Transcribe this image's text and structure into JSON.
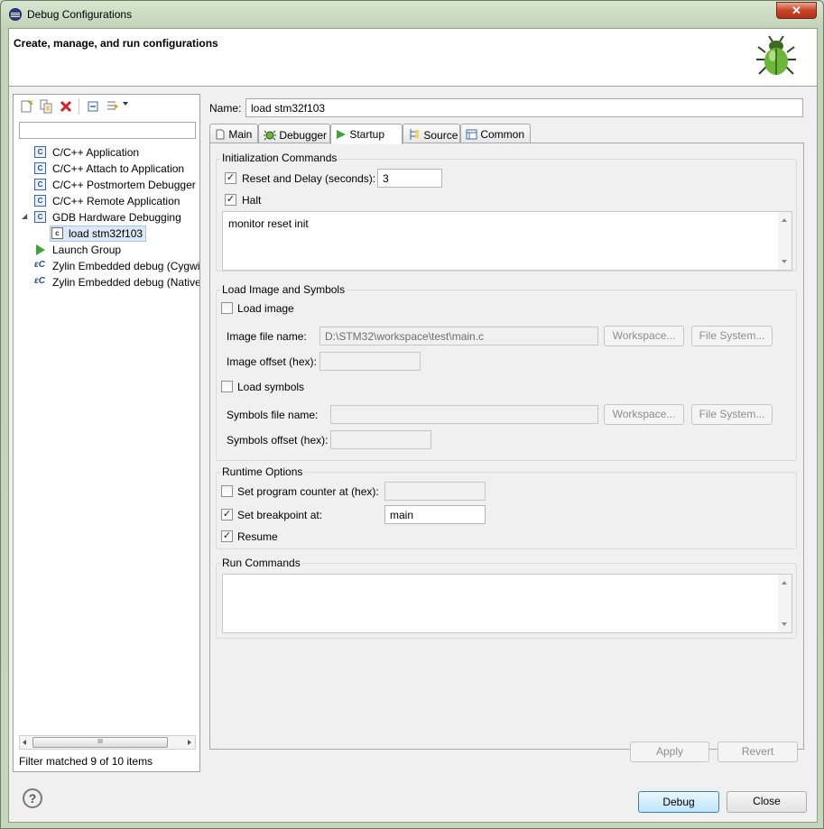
{
  "window": {
    "title": "Debug Configurations",
    "close_glyph": "✕"
  },
  "header": {
    "title": "Create, manage, and run configurations",
    "icon": "bug-icon"
  },
  "left": {
    "toolbar": [
      {
        "name": "new-config-icon"
      },
      {
        "name": "duplicate-config-icon"
      },
      {
        "name": "delete-config-icon"
      },
      {
        "name": "collapse-all-icon"
      },
      {
        "name": "filter-config-icon"
      }
    ],
    "filter_text": "",
    "tree": [
      {
        "label": "C/C++ Application",
        "icon": "c-config-icon",
        "indent": 0,
        "expander": ""
      },
      {
        "label": "C/C++ Attach to Application",
        "icon": "c-config-icon",
        "indent": 0,
        "expander": ""
      },
      {
        "label": "C/C++ Postmortem Debugger",
        "icon": "c-config-icon",
        "indent": 0,
        "expander": ""
      },
      {
        "label": "C/C++ Remote Application",
        "icon": "c-config-icon",
        "indent": 0,
        "expander": ""
      },
      {
        "label": "GDB Hardware Debugging",
        "icon": "c-config-icon",
        "indent": 0,
        "expander": "◢"
      },
      {
        "label": "load stm32f103",
        "icon": "c-config-icon",
        "indent": 1,
        "expander": "",
        "selected": true
      },
      {
        "label": "Launch Group",
        "icon": "launch-group-icon",
        "indent": 0,
        "expander": ""
      },
      {
        "label": "Zylin Embedded debug (Cygwin)",
        "icon": "zylin-icon",
        "indent": 0,
        "expander": ""
      },
      {
        "label": "Zylin Embedded debug (Native)",
        "icon": "zylin-icon",
        "indent": 0,
        "expander": ""
      }
    ],
    "scroll_mark": "III",
    "filter_status": "Filter matched 9 of 10 items"
  },
  "right": {
    "name_label": "Name:",
    "name_value": "load stm32f103",
    "tabs": [
      {
        "label": "Main",
        "icon": "main-tab-icon"
      },
      {
        "label": "Debugger",
        "icon": "debugger-tab-icon"
      },
      {
        "label": "Startup",
        "icon": "startup-tab-icon",
        "selected": true
      },
      {
        "label": "Source",
        "icon": "source-tab-icon"
      },
      {
        "label": "Common",
        "icon": "common-tab-icon"
      }
    ],
    "init": {
      "title": "Initialization Commands",
      "reset_label": "Reset and Delay (seconds):",
      "reset_checked": true,
      "reset_delay": "3",
      "halt_label": "Halt",
      "halt_checked": true,
      "commands": "monitor reset init"
    },
    "load": {
      "title": "Load Image and Symbols",
      "load_image_label": "Load image",
      "load_image_checked": false,
      "image_file_label": "Image file name:",
      "image_file_value": "D:\\STM32\\workspace\\test\\main.c",
      "workspace_label": "Workspace...",
      "filesystem_label": "File System...",
      "image_offset_label": "Image offset (hex):",
      "image_offset_value": "",
      "load_symbols_label": "Load symbols",
      "load_symbols_checked": false,
      "symbols_file_label": "Symbols file name:",
      "symbols_file_value": "",
      "symbols_offset_label": "Symbols offset (hex):",
      "symbols_offset_value": ""
    },
    "runtime": {
      "title": "Runtime Options",
      "pc_label": "Set program counter at (hex):",
      "pc_checked": false,
      "pc_value": "",
      "bp_label": "Set breakpoint at:",
      "bp_checked": true,
      "bp_value": "main",
      "resume_label": "Resume",
      "resume_checked": true
    },
    "run": {
      "title": "Run Commands",
      "commands": ""
    },
    "apply_label": "Apply",
    "revert_label": "Revert"
  },
  "footer": {
    "help_glyph": "?",
    "debug_label": "Debug",
    "close_label": "Close"
  },
  "colors": {
    "titlebar": "#c9d9c0",
    "close": "#c9452a",
    "selection": "#dde8f6",
    "debug_button": "#bee6fd"
  }
}
